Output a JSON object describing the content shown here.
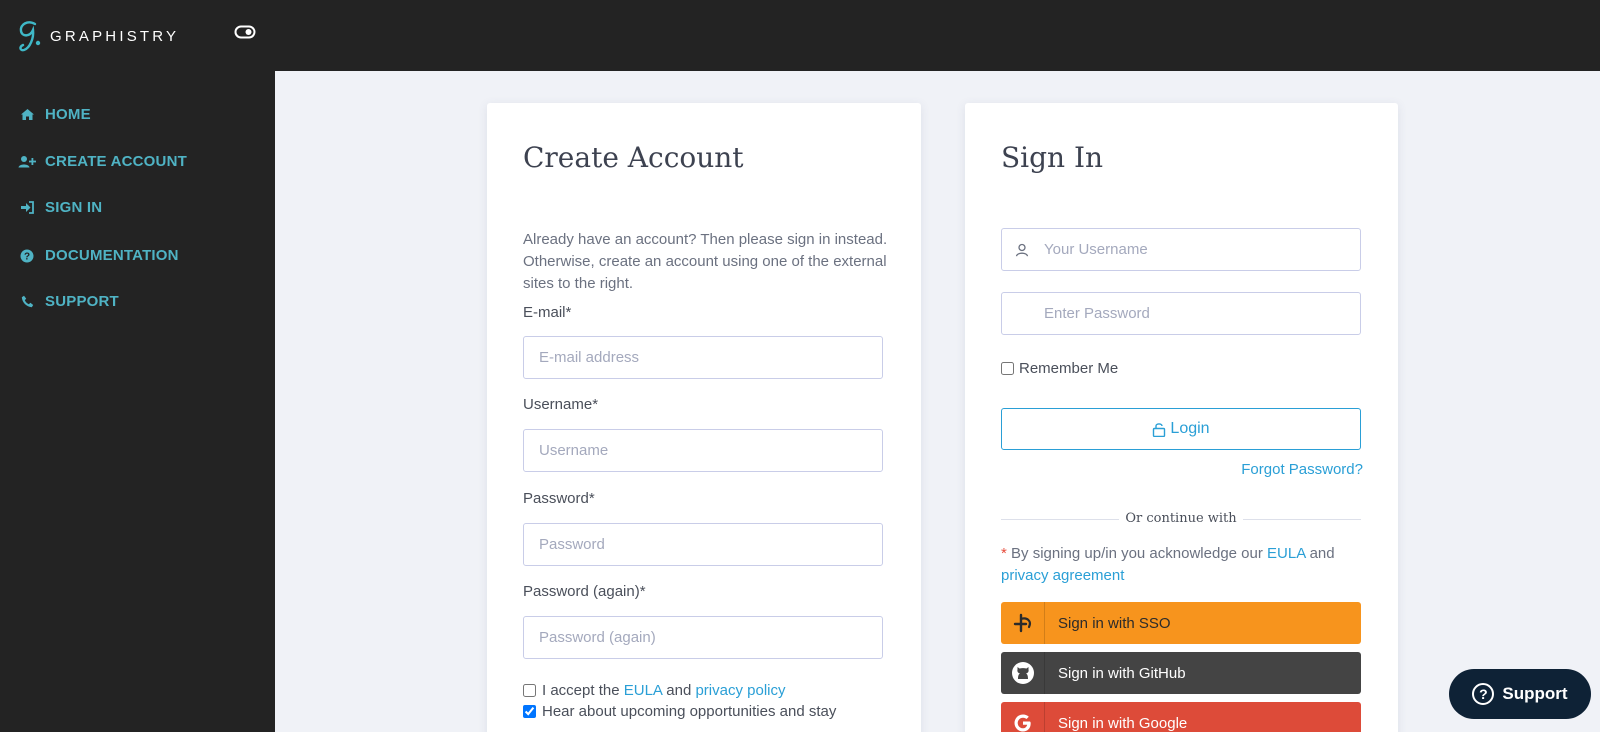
{
  "app": {
    "brand": "GRAPHISTRY"
  },
  "sidebar": {
    "items": [
      {
        "label": "HOME",
        "icon": "home-icon"
      },
      {
        "label": "CREATE ACCOUNT",
        "icon": "user-plus-icon"
      },
      {
        "label": "SIGN IN",
        "icon": "sign-in-icon"
      },
      {
        "label": "DOCUMENTATION",
        "icon": "question-circle-icon"
      },
      {
        "label": "SUPPORT",
        "icon": "phone-icon"
      }
    ]
  },
  "create_account": {
    "title": "Create Account",
    "intro": "Already have an account? Then please sign in instead. Otherwise, create an account using one of the external sites to the right.",
    "email": {
      "label": "E-mail*",
      "placeholder": "E-mail address"
    },
    "username": {
      "label": "Username*",
      "placeholder": "Username"
    },
    "password": {
      "label": "Password*",
      "placeholder": "Password"
    },
    "password2": {
      "label": "Password (again)*",
      "placeholder": "Password (again)"
    },
    "accept": {
      "prefix": "I accept the",
      "eula": "EULA",
      "and": "and",
      "privacy": "privacy policy",
      "checked": false
    },
    "news": {
      "label": "Hear about upcoming opportunities and stay",
      "checked": true
    }
  },
  "sign_in": {
    "title": "Sign In",
    "username_placeholder": "Your Username",
    "password_placeholder": "Enter Password",
    "remember_label": "Remember Me",
    "login_label": "Login",
    "forgot_label": "Forgot Password?",
    "divider_text": "Or continue with",
    "ack": {
      "star": "*",
      "text": "By signing up/in you acknowledge our",
      "eula": "EULA",
      "and": "and",
      "privacy": "privacy agreement"
    },
    "oauth": [
      {
        "label": "Sign in with SSO",
        "color": "#f7941d"
      },
      {
        "label": "Sign in with GitHub",
        "color": "#444444"
      },
      {
        "label": "Sign in with Google",
        "color": "#dd4b39"
      }
    ]
  },
  "support_button": {
    "label": "Support"
  },
  "colors": {
    "accent": "#2a9fd6",
    "nav_text": "#4fb3c4",
    "sidebar_bg": "#232323"
  }
}
